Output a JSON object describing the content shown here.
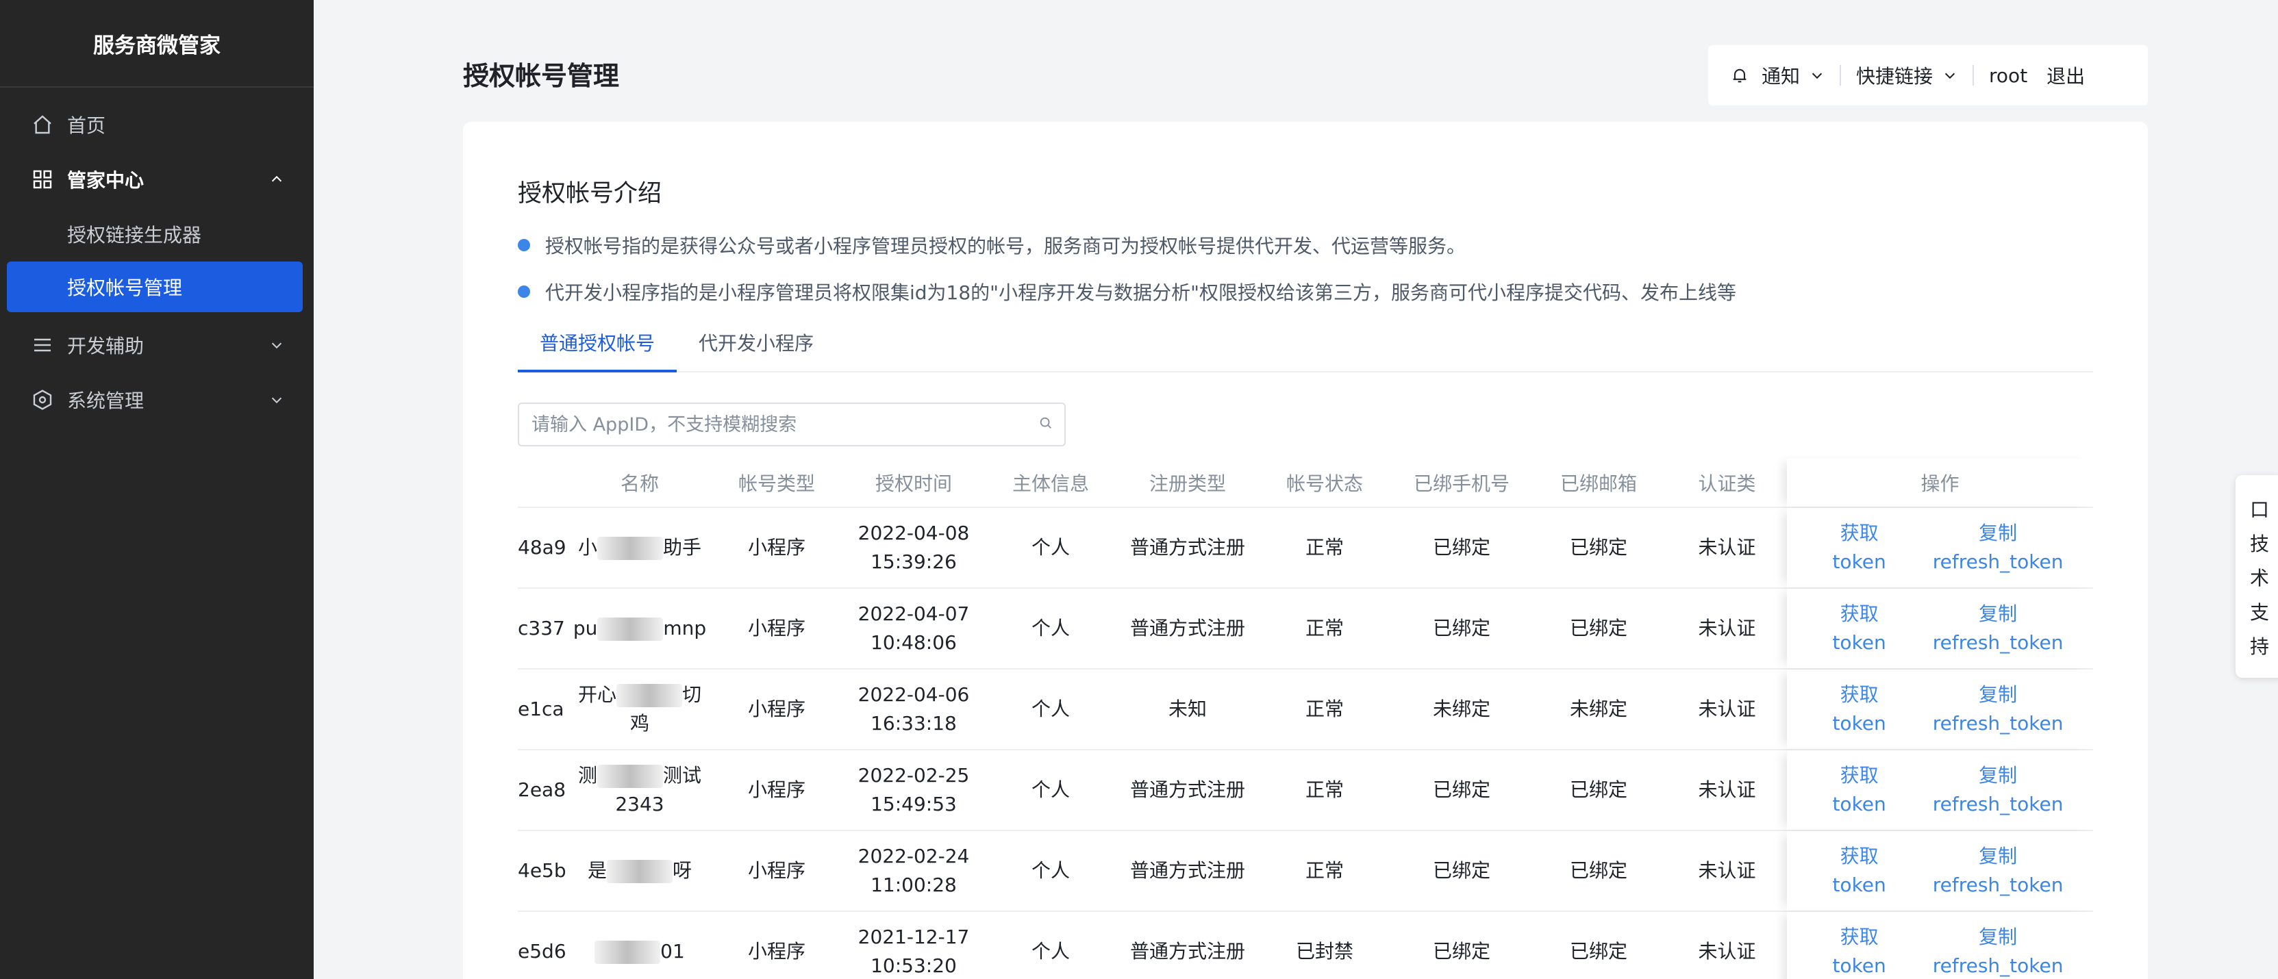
{
  "app": {
    "brand": "服务商微管家"
  },
  "sidebar": {
    "home": "首页",
    "manager_center": "管家中心",
    "sub_items": [
      "授权链接生成器",
      "授权帐号管理"
    ],
    "dev_assist": "开发辅助",
    "system_mgmt": "系统管理"
  },
  "page": {
    "title": "授权帐号管理"
  },
  "topbar": {
    "notify": "通知",
    "quick_links": "快捷链接",
    "user": "root",
    "logout": "退出"
  },
  "intro": {
    "title": "授权帐号介绍",
    "bullets": [
      "授权帐号指的是获得公众号或者小程序管理员授权的帐号，服务商可为授权帐号提供代开发、代运营等服务。",
      "代开发小程序指的是小程序管理员将权限集id为18的\"小程序开发与数据分析\"权限授权给该第三方，服务商可代小程序提交代码、发布上线等"
    ]
  },
  "tabs": [
    "普通授权帐号",
    "代开发小程序"
  ],
  "search": {
    "placeholder": "请输入 AppID，不支持模糊搜索"
  },
  "table": {
    "headers": {
      "name": "名称",
      "type": "帐号类型",
      "time": "授权时间",
      "subject": "主体信息",
      "reg": "注册类型",
      "status": "帐号状态",
      "phone": "已绑手机号",
      "mail": "已绑邮箱",
      "cert": "认证类",
      "ops": "操作"
    },
    "op_labels": {
      "get_token": "获取token",
      "copy_refresh": "复制refresh_token"
    },
    "rows": [
      {
        "id": "48a9",
        "name_pre": "小",
        "name_post": "助手",
        "name_line2": "",
        "type": "小程序",
        "date": "2022-04-08",
        "clock": "15:39:26",
        "subject": "个人",
        "reg": "普通方式注册",
        "status": "正常",
        "phone": "已绑定",
        "mail": "已绑定",
        "cert": "未认证"
      },
      {
        "id": "c337",
        "name_pre": "pu",
        "name_post": "mnp",
        "name_line2": "",
        "type": "小程序",
        "date": "2022-04-07",
        "clock": "10:48:06",
        "subject": "个人",
        "reg": "普通方式注册",
        "status": "正常",
        "phone": "已绑定",
        "mail": "已绑定",
        "cert": "未认证"
      },
      {
        "id": "e1ca",
        "name_pre": "开心",
        "name_post": "切",
        "name_line2": "鸡",
        "type": "小程序",
        "date": "2022-04-06",
        "clock": "16:33:18",
        "subject": "个人",
        "reg": "未知",
        "status": "正常",
        "phone": "未绑定",
        "mail": "未绑定",
        "cert": "未认证"
      },
      {
        "id": "2ea8",
        "name_pre": "测",
        "name_post": "测试",
        "name_line2": "2343",
        "type": "小程序",
        "date": "2022-02-25",
        "clock": "15:49:53",
        "subject": "个人",
        "reg": "普通方式注册",
        "status": "正常",
        "phone": "已绑定",
        "mail": "已绑定",
        "cert": "未认证"
      },
      {
        "id": "4e5b",
        "name_pre": "是",
        "name_post": "呀",
        "name_line2": "",
        "type": "小程序",
        "date": "2022-02-24",
        "clock": "11:00:28",
        "subject": "个人",
        "reg": "普通方式注册",
        "status": "正常",
        "phone": "已绑定",
        "mail": "已绑定",
        "cert": "未认证"
      },
      {
        "id": "e5d6",
        "name_pre": "",
        "name_post": "01",
        "name_line2": "",
        "type": "小程序",
        "date": "2021-12-17",
        "clock": "10:53:20",
        "subject": "个人",
        "reg": "普通方式注册",
        "status": "已封禁",
        "phone": "已绑定",
        "mail": "已绑定",
        "cert": "未认证"
      }
    ]
  },
  "support": {
    "chars": [
      "口",
      "技",
      "术",
      "支",
      "持"
    ]
  },
  "colors": {
    "sidebar_bg": "#262626",
    "accent": "#1b5ce0",
    "link": "#3b86e8",
    "page_bg": "#f3f4f6"
  }
}
